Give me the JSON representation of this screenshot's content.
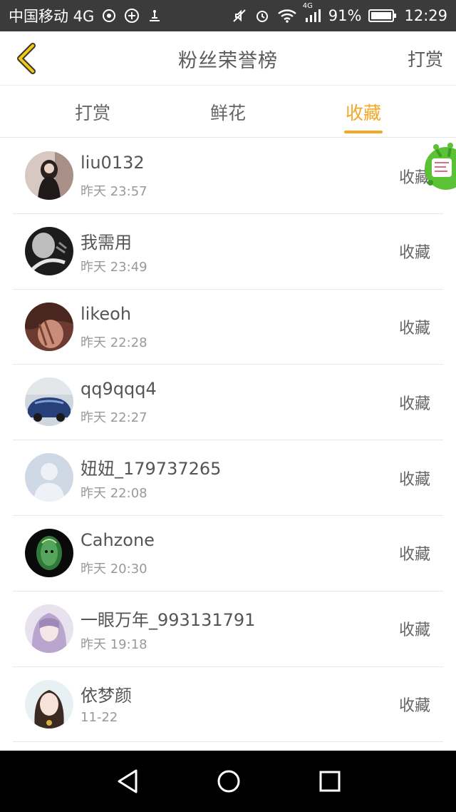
{
  "status_bar": {
    "carrier": "中国移动 4G",
    "network_small": "4G",
    "battery": "91%",
    "time": "12:29"
  },
  "header": {
    "title": "粉丝荣誉榜",
    "action": "打赏"
  },
  "tabs": [
    {
      "label": "打赏",
      "active": false
    },
    {
      "label": "鲜花",
      "active": false
    },
    {
      "label": "收藏",
      "active": true
    }
  ],
  "accent_color": "#f5a623",
  "list": [
    {
      "name": "liu0132",
      "time": "昨天 23:57",
      "action": "收藏"
    },
    {
      "name": "我需用",
      "time": "昨天 23:49",
      "action": "收藏"
    },
    {
      "name": "likeoh",
      "time": "昨天 22:28",
      "action": "收藏"
    },
    {
      "name": "qq9qqq4",
      "time": "昨天 22:27",
      "action": "收藏"
    },
    {
      "name": "妞妞_179737265",
      "time": "昨天 22:08",
      "action": "收藏"
    },
    {
      "name": "Cahzone",
      "time": "昨天 20:30",
      "action": "收藏"
    },
    {
      "name": "一眼万年_993131791",
      "time": "昨天 19:18",
      "action": "收藏"
    },
    {
      "name": "依梦颜",
      "time": "11-22",
      "action": "收藏"
    }
  ]
}
